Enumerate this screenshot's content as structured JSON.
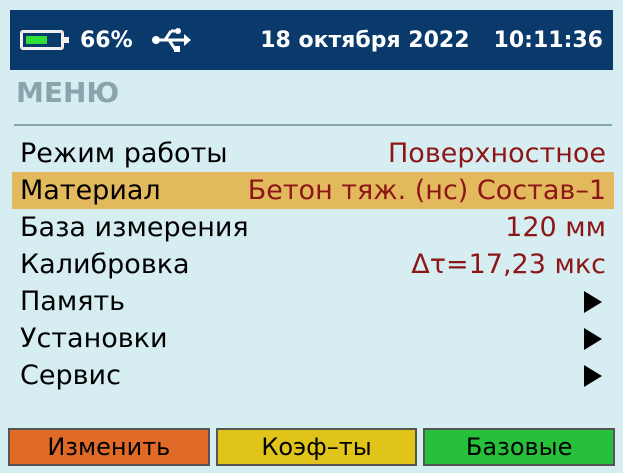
{
  "status": {
    "battery_percent": "66%",
    "battery_level": 0.66,
    "date": "18 октября 2022",
    "time": "10:11:36",
    "colors": {
      "bar": "#0a3a6b",
      "battery_fill": "#2edc3a"
    }
  },
  "menu": {
    "title": "МЕНЮ",
    "items": [
      {
        "label": "Режим работы",
        "value": "Поверхностное",
        "type": "value"
      },
      {
        "label": "Материал",
        "value": "Бетон тяж. (нс) Состав–1",
        "type": "value",
        "selected": true
      },
      {
        "label": "База измерения",
        "value": "120 мм",
        "type": "value"
      },
      {
        "label": "Калибровка",
        "value": "Δτ=17,23 мкс",
        "type": "value"
      },
      {
        "label": "Память",
        "type": "submenu"
      },
      {
        "label": "Установки",
        "type": "submenu"
      },
      {
        "label": "Сервис",
        "type": "submenu"
      }
    ]
  },
  "softkeys": {
    "left": {
      "label": "Изменить",
      "color": "#e06a28"
    },
    "middle": {
      "label": "Коэф–ты",
      "color": "#e0c419"
    },
    "right": {
      "label": "Базовые",
      "color": "#26c03a"
    }
  }
}
